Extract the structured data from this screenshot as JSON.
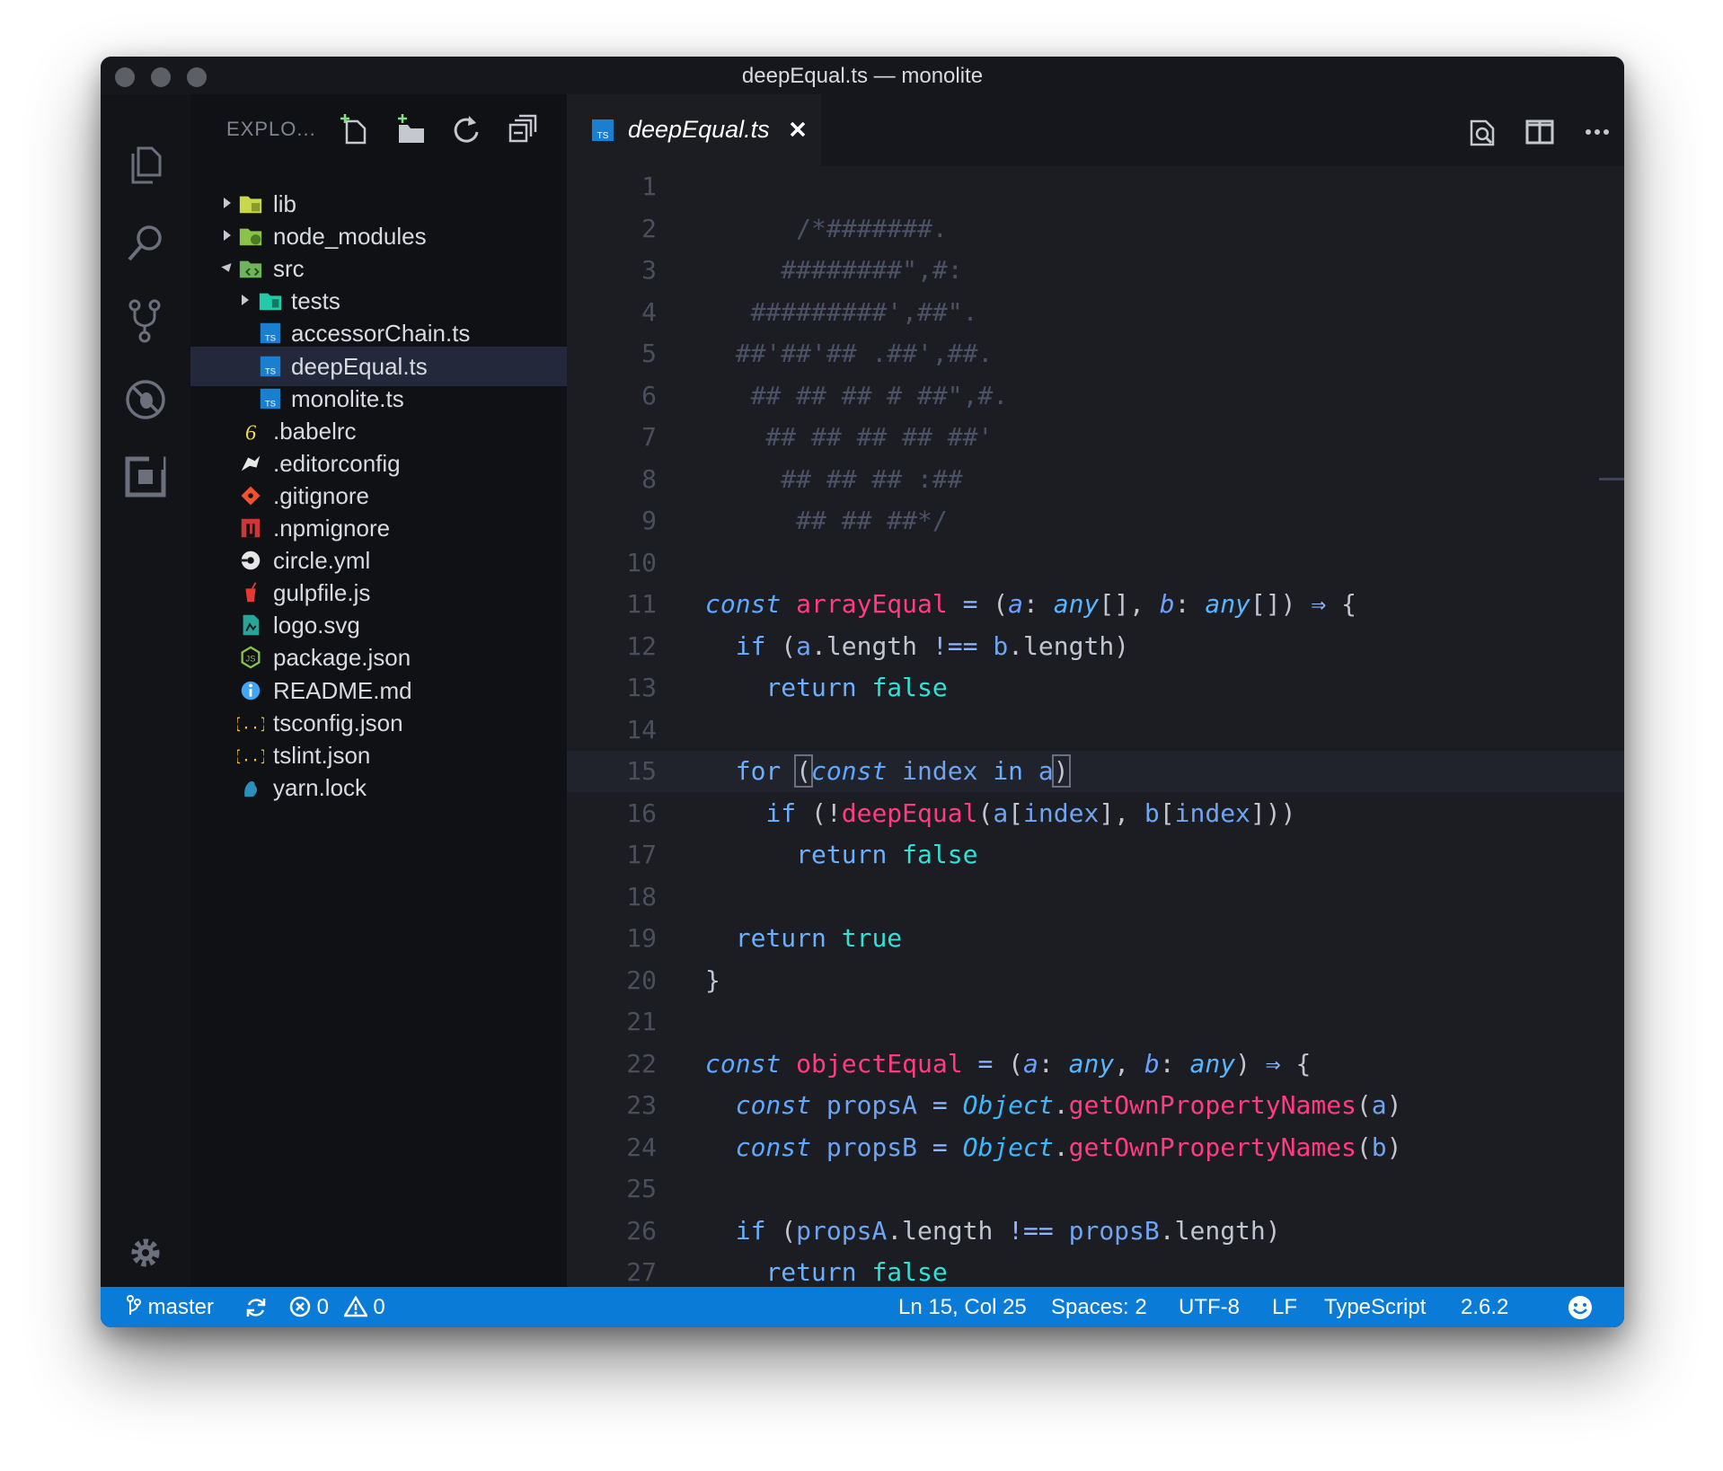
{
  "window": {
    "title": "deepEqual.ts — monolite"
  },
  "activity_bar": {
    "icons": [
      "files-icon",
      "search-icon",
      "source-control-icon",
      "debug-icon",
      "extensions-icon",
      "gear-icon"
    ]
  },
  "sidebar": {
    "title": "EXPLO...",
    "actions": [
      "new-file-icon",
      "new-folder-icon",
      "refresh-icon",
      "collapse-all-icon"
    ],
    "tree": [
      {
        "label": "lib",
        "type": "folder",
        "expanded": false,
        "depth": 0,
        "icon": "folder-lib-icon"
      },
      {
        "label": "node_modules",
        "type": "folder",
        "expanded": false,
        "depth": 0,
        "icon": "folder-node-icon"
      },
      {
        "label": "src",
        "type": "folder",
        "expanded": true,
        "depth": 0,
        "icon": "folder-src-icon"
      },
      {
        "label": "tests",
        "type": "folder",
        "expanded": false,
        "depth": 1,
        "icon": "folder-tests-icon"
      },
      {
        "label": "accessorChain.ts",
        "type": "file",
        "depth": 1,
        "icon": "typescript-icon"
      },
      {
        "label": "deepEqual.ts",
        "type": "file",
        "depth": 1,
        "icon": "typescript-icon",
        "selected": true
      },
      {
        "label": "monolite.ts",
        "type": "file",
        "depth": 1,
        "icon": "typescript-icon"
      },
      {
        "label": ".babelrc",
        "type": "file",
        "depth": 0,
        "icon": "babel-icon"
      },
      {
        "label": ".editorconfig",
        "type": "file",
        "depth": 0,
        "icon": "editorconfig-icon"
      },
      {
        "label": ".gitignore",
        "type": "file",
        "depth": 0,
        "icon": "git-icon"
      },
      {
        "label": ".npmignore",
        "type": "file",
        "depth": 0,
        "icon": "npm-icon"
      },
      {
        "label": "circle.yml",
        "type": "file",
        "depth": 0,
        "icon": "circleci-icon"
      },
      {
        "label": "gulpfile.js",
        "type": "file",
        "depth": 0,
        "icon": "gulp-icon"
      },
      {
        "label": "logo.svg",
        "type": "file",
        "depth": 0,
        "icon": "svg-icon"
      },
      {
        "label": "package.json",
        "type": "file",
        "depth": 0,
        "icon": "nodejs-icon"
      },
      {
        "label": "README.md",
        "type": "file",
        "depth": 0,
        "icon": "info-icon"
      },
      {
        "label": "tsconfig.json",
        "type": "file",
        "depth": 0,
        "icon": "json-icon"
      },
      {
        "label": "tslint.json",
        "type": "file",
        "depth": 0,
        "icon": "json-icon"
      },
      {
        "label": "yarn.lock",
        "type": "file",
        "depth": 0,
        "icon": "yarn-icon"
      }
    ]
  },
  "editor": {
    "tab": {
      "label": "deepEqual.ts",
      "icon": "typescript-icon"
    },
    "actions": [
      "open-preview-icon",
      "split-editor-icon",
      "more-icon"
    ],
    "current_line": 15,
    "lines": [
      [],
      [
        [
          "c-comment",
          "      /*#######."
        ]
      ],
      [
        [
          "c-comment",
          "     ########\",#:"
        ]
      ],
      [
        [
          "c-comment",
          "   #########',##\"."
        ]
      ],
      [
        [
          "c-comment",
          "  ##'##'## .##',##."
        ]
      ],
      [
        [
          "c-comment",
          "   ## ## ## # ##\",#."
        ]
      ],
      [
        [
          "c-comment",
          "    ## ## ## ## ##'"
        ]
      ],
      [
        [
          "c-comment",
          "     ## ## ## :##"
        ]
      ],
      [
        [
          "c-comment",
          "      ## ## ##*/"
        ]
      ],
      [],
      [
        [
          "c-kw",
          "const"
        ],
        [
          "c-punc",
          " "
        ],
        [
          "c-fn",
          "arrayEqual"
        ],
        [
          "c-punc",
          " "
        ],
        [
          "c-op",
          "="
        ],
        [
          "c-punc",
          " ("
        ],
        [
          "c-param",
          "a"
        ],
        [
          "c-punc",
          ": "
        ],
        [
          "c-type",
          "any"
        ],
        [
          "c-punc",
          "[], "
        ],
        [
          "c-param",
          "b"
        ],
        [
          "c-punc",
          ": "
        ],
        [
          "c-type",
          "any"
        ],
        [
          "c-punc",
          "[]) "
        ],
        [
          "c-op",
          "⇒"
        ],
        [
          "c-punc",
          " {"
        ]
      ],
      [
        [
          "c-punc",
          "  "
        ],
        [
          "c-ctrl",
          "if"
        ],
        [
          "c-punc",
          " ("
        ],
        [
          "c-var",
          "a"
        ],
        [
          "c-punc",
          ".length "
        ],
        [
          "c-op",
          "!=="
        ],
        [
          "c-punc",
          " "
        ],
        [
          "c-var",
          "b"
        ],
        [
          "c-punc",
          ".length)"
        ]
      ],
      [
        [
          "c-punc",
          "    "
        ],
        [
          "c-ctrl",
          "return"
        ],
        [
          "c-punc",
          " "
        ],
        [
          "c-bool",
          "false"
        ]
      ],
      [],
      [
        [
          "c-punc",
          "  "
        ],
        [
          "c-ctrl",
          "for"
        ],
        [
          "c-punc",
          " "
        ],
        [
          "cursor-box c-punc",
          "("
        ],
        [
          "c-kw",
          "const"
        ],
        [
          "c-punc",
          " "
        ],
        [
          "c-var",
          "index"
        ],
        [
          "c-punc",
          " "
        ],
        [
          "c-ctrl",
          "in"
        ],
        [
          "c-punc",
          " "
        ],
        [
          "c-var",
          "a"
        ],
        [
          "cursor-box c-punc",
          ")"
        ]
      ],
      [
        [
          "c-punc",
          "    "
        ],
        [
          "c-ctrl",
          "if"
        ],
        [
          "c-punc",
          " (!"
        ],
        [
          "c-fn",
          "deepEqual"
        ],
        [
          "c-punc",
          "("
        ],
        [
          "c-var",
          "a"
        ],
        [
          "c-punc",
          "["
        ],
        [
          "c-var",
          "index"
        ],
        [
          "c-punc",
          "], "
        ],
        [
          "c-var",
          "b"
        ],
        [
          "c-punc",
          "["
        ],
        [
          "c-var",
          "index"
        ],
        [
          "c-punc",
          "]))"
        ]
      ],
      [
        [
          "c-punc",
          "      "
        ],
        [
          "c-ctrl",
          "return"
        ],
        [
          "c-punc",
          " "
        ],
        [
          "c-bool",
          "false"
        ]
      ],
      [],
      [
        [
          "c-punc",
          "  "
        ],
        [
          "c-ctrl",
          "return"
        ],
        [
          "c-punc",
          " "
        ],
        [
          "c-bool",
          "true"
        ]
      ],
      [
        [
          "c-punc",
          "}"
        ]
      ],
      [],
      [
        [
          "c-kw",
          "const"
        ],
        [
          "c-punc",
          " "
        ],
        [
          "c-fn",
          "objectEqual"
        ],
        [
          "c-punc",
          " "
        ],
        [
          "c-op",
          "="
        ],
        [
          "c-punc",
          " ("
        ],
        [
          "c-param",
          "a"
        ],
        [
          "c-punc",
          ": "
        ],
        [
          "c-type",
          "any"
        ],
        [
          "c-punc",
          ", "
        ],
        [
          "c-param",
          "b"
        ],
        [
          "c-punc",
          ": "
        ],
        [
          "c-type",
          "any"
        ],
        [
          "c-punc",
          ") "
        ],
        [
          "c-op",
          "⇒"
        ],
        [
          "c-punc",
          " {"
        ]
      ],
      [
        [
          "c-punc",
          "  "
        ],
        [
          "c-kw",
          "const"
        ],
        [
          "c-punc",
          " "
        ],
        [
          "c-var",
          "propsA"
        ],
        [
          "c-punc",
          " "
        ],
        [
          "c-op",
          "="
        ],
        [
          "c-punc",
          " "
        ],
        [
          "c-obj",
          "Object"
        ],
        [
          "c-punc",
          "."
        ],
        [
          "c-fn",
          "getOwnPropertyNames"
        ],
        [
          "c-punc",
          "("
        ],
        [
          "c-var",
          "a"
        ],
        [
          "c-punc",
          ")"
        ]
      ],
      [
        [
          "c-punc",
          "  "
        ],
        [
          "c-kw",
          "const"
        ],
        [
          "c-punc",
          " "
        ],
        [
          "c-var",
          "propsB"
        ],
        [
          "c-punc",
          " "
        ],
        [
          "c-op",
          "="
        ],
        [
          "c-punc",
          " "
        ],
        [
          "c-obj",
          "Object"
        ],
        [
          "c-punc",
          "."
        ],
        [
          "c-fn",
          "getOwnPropertyNames"
        ],
        [
          "c-punc",
          "("
        ],
        [
          "c-var",
          "b"
        ],
        [
          "c-punc",
          ")"
        ]
      ],
      [],
      [
        [
          "c-punc",
          "  "
        ],
        [
          "c-ctrl",
          "if"
        ],
        [
          "c-punc",
          " ("
        ],
        [
          "c-var",
          "propsA"
        ],
        [
          "c-punc",
          ".length "
        ],
        [
          "c-op",
          "!=="
        ],
        [
          "c-punc",
          " "
        ],
        [
          "c-var",
          "propsB"
        ],
        [
          "c-punc",
          ".length)"
        ]
      ],
      [
        [
          "c-punc",
          "    "
        ],
        [
          "c-ctrl",
          "return"
        ],
        [
          "c-punc",
          " "
        ],
        [
          "c-bool",
          "false"
        ]
      ]
    ]
  },
  "statusbar": {
    "branch": "master",
    "errors": "0",
    "warnings": "0",
    "position": "Ln 15, Col 25",
    "spaces": "Spaces: 2",
    "encoding": "UTF-8",
    "eol": "LF",
    "language": "TypeScript",
    "version": "2.6.2"
  }
}
